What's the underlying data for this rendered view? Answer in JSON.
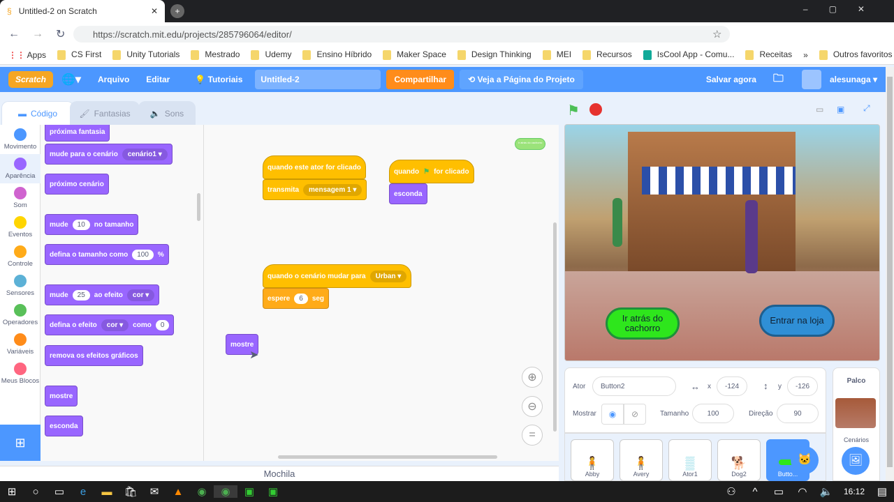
{
  "browser": {
    "tab_title": "Untitled-2 on Scratch",
    "url": "https://scratch.mit.edu/projects/285796064/editor/",
    "bookmarks": [
      "Apps",
      "CS First",
      "Unity Tutorials",
      "Mestrado",
      "Udemy",
      "Ensino Híbrido",
      "Maker Space",
      "Design Thinking",
      "MEI",
      "Recursos",
      "IsCool App - Comu...",
      "Receitas"
    ],
    "other_bookmarks": "Outros favoritos"
  },
  "menubar": {
    "logo": "Scratch",
    "file": "Arquivo",
    "edit": "Editar",
    "tutorials": "Tutoriais",
    "project_title": "Untitled-2",
    "share": "Compartilhar",
    "project_page": "Veja a Página do Projeto",
    "save": "Salvar agora",
    "username": "alesunaga",
    "color": "#4c97ff"
  },
  "editor_tabs": [
    "Código",
    "Fantasias",
    "Sons"
  ],
  "categories": [
    {
      "label": "Movimento",
      "color": "#4c97ff"
    },
    {
      "label": "Aparência",
      "color": "#9966ff"
    },
    {
      "label": "Som",
      "color": "#cf63cf"
    },
    {
      "label": "Eventos",
      "color": "#ffd500"
    },
    {
      "label": "Controle",
      "color": "#ffab19"
    },
    {
      "label": "Sensores",
      "color": "#5cb1d6"
    },
    {
      "label": "Operadores",
      "color": "#59c059"
    },
    {
      "label": "Variáveis",
      "color": "#ff8c1a"
    },
    {
      "label": "Meus Blocos",
      "color": "#ff6680"
    }
  ],
  "palette": {
    "b0": "próxima fantasia",
    "b1": "mude para o cenário",
    "b1_dd": "cenário1",
    "b2": "próximo cenário",
    "b3a": "mude",
    "b3v": "10",
    "b3b": "no tamanho",
    "b4a": "defina o tamanho como",
    "b4v": "100",
    "b4b": "%",
    "b5a": "mude",
    "b5v": "25",
    "b5b": "ao efeito",
    "b5dd": "cor",
    "b6a": "defina o efeito",
    "b6dd": "cor",
    "b6b": "como",
    "b6v": "0",
    "b7": "remova os efeitos gráficos",
    "b8": "mostre",
    "b9": "esconda"
  },
  "scripts": {
    "s1_hat": "quando este ator for clicado",
    "s1_b": "transmita",
    "s1_dd": "mensagem 1",
    "s2_hat_a": "quando",
    "s2_hat_b": "for clicado",
    "s2_b": "esconda",
    "s3_hat": "quando o cenário mudar para",
    "s3_dd": "Urban",
    "s3_a": "espere",
    "s3_v": "6",
    "s3_b": "seg",
    "loose": "mostre",
    "bubble": "Ir atrás do cachorro"
  },
  "stage": {
    "btn1": "Ir atrás do cachorro",
    "btn2": "Entrar na loja"
  },
  "sprite_info": {
    "sprite_label": "Ator",
    "sprite_name": "Button2",
    "x_label": "x",
    "x": "-124",
    "y_label": "y",
    "y": "-126",
    "show_label": "Mostrar",
    "size_label": "Tamanho",
    "size": "100",
    "dir_label": "Direção",
    "direction": "90"
  },
  "sprites": [
    "Abby",
    "Avery",
    "Ator1",
    "Dog2",
    "Butto..."
  ],
  "stage_panel": {
    "title": "Palco",
    "backdrops": "Cenários"
  },
  "mochila": "Mochila",
  "taskbar": {
    "time": "16:12"
  }
}
